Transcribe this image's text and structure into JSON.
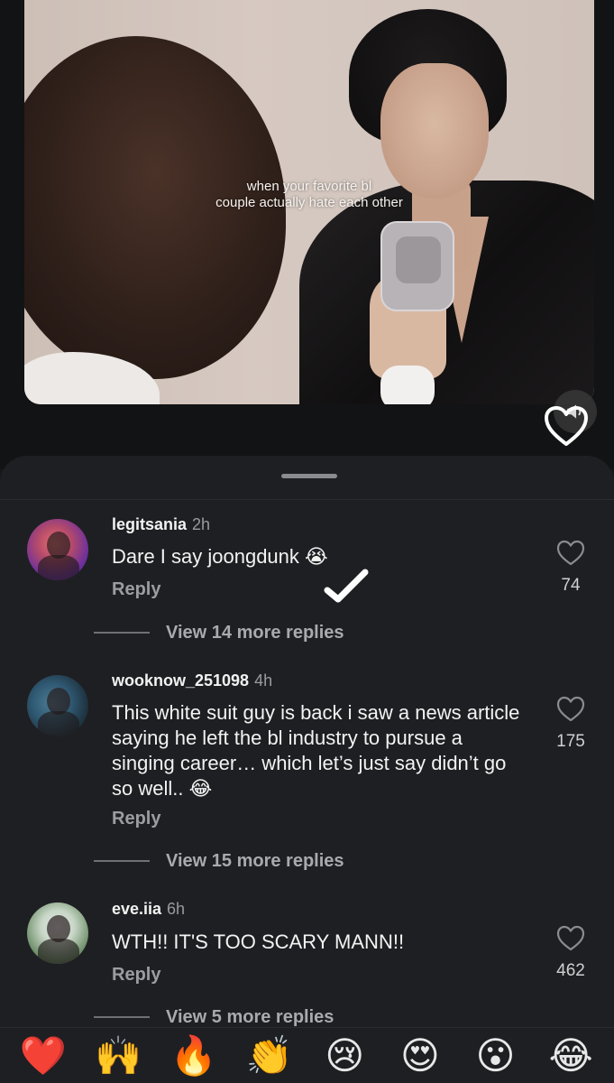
{
  "video": {
    "caption_lines": [
      "when your favorite bl",
      "couple actually hate each other"
    ],
    "sound_icon": "speaker-muted-icon",
    "like_icon": "heart-outline-icon"
  },
  "comments": [
    {
      "username": "legitsania",
      "time": "2h",
      "text": "Dare I say joongdunk ",
      "emoji": "😭",
      "reply_label": "Reply",
      "likes": "74",
      "view_more": "View 14 more replies"
    },
    {
      "username": "wooknow_251098",
      "time": "4h",
      "text": "This white suit guy is back i saw a news article saying he left the bl industry to pursue a singing career… which let’s just say didn’t go so well.. ",
      "emoji": "😂",
      "reply_label": "Reply",
      "likes": "175",
      "view_more": "View 15 more replies"
    },
    {
      "username": "eve.iia",
      "time": "6h",
      "text": "WTH!! IT'S TOO SCARY MANN!!",
      "emoji": "",
      "reply_label": "Reply",
      "likes": "462",
      "view_more": "View 5 more replies"
    }
  ],
  "reactions": [
    "❤️",
    "🙌",
    "🔥",
    "👏",
    "😢",
    "😍",
    "😮",
    "😂"
  ],
  "colors": {
    "background": "#17181a",
    "sheet": "#1e1f22",
    "muted_text": "#9c9da0"
  }
}
